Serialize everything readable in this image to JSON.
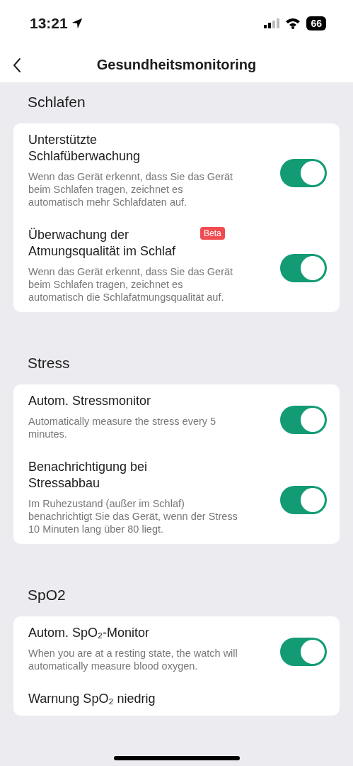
{
  "status_bar": {
    "time": "13:21",
    "battery": "66"
  },
  "nav": {
    "title": "Gesundheitsmonitoring"
  },
  "sections": [
    {
      "title": "Schlafen",
      "items": [
        {
          "kind": "toggle",
          "title": "Unterstützte Schlafüberwachung",
          "description": "Wenn das Gerät erkennt, dass Sie das Gerät beim Schlafen tragen, zeichnet es automatisch mehr Schlafdaten auf.",
          "on": true
        },
        {
          "kind": "toggle",
          "title": "Überwachung der Atmungsqualität im Schlaf",
          "badge": "Beta",
          "description": "Wenn das Gerät erkennt, dass Sie das Gerät beim Schlafen tragen, zeichnet es automatisch die Schlafatmungsqualität auf.",
          "on": true
        }
      ]
    },
    {
      "title": "Stress",
      "items": [
        {
          "kind": "toggle",
          "title": "Autom. Stressmonitor",
          "description": "Automatically measure the stress every 5 minutes.",
          "on": true
        },
        {
          "kind": "toggle",
          "title": "Benachrichtigung bei Stressabbau",
          "description": "Im Ruhezustand (außer im Schlaf) benachrichtigt Sie das Gerät, wenn der Stress 10 Minuten lang über 80 liegt.",
          "on": true
        }
      ]
    },
    {
      "title": "SpO2",
      "items": [
        {
          "kind": "toggle",
          "title": "Autom. SpO₂-Monitor",
          "description": "When you are at a resting state, the watch will automatically measure blood oxygen.",
          "on": true
        },
        {
          "kind": "label",
          "title": "Warnung SpO₂ niedrig"
        }
      ]
    }
  ]
}
